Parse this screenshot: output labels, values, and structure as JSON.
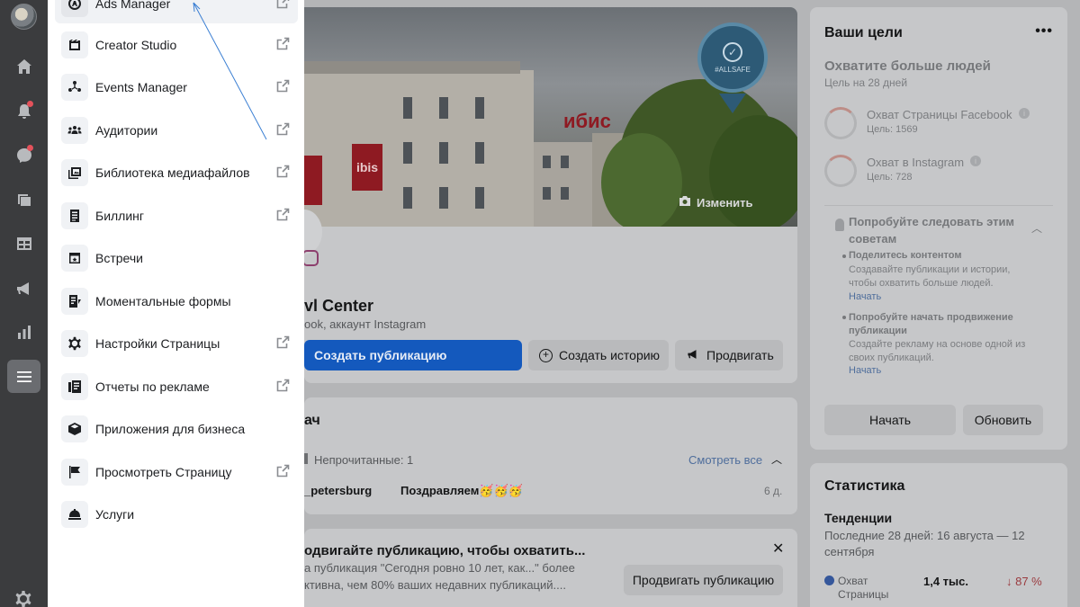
{
  "rail": {
    "items": [
      "home",
      "notifications",
      "messages",
      "pages",
      "grid",
      "ads",
      "insights",
      "menu",
      "settings"
    ]
  },
  "menu": {
    "items": [
      {
        "label": "Ads Manager",
        "icon": "ads-manager-icon",
        "external": true
      },
      {
        "label": "Creator Studio",
        "icon": "creator-studio-icon",
        "external": true
      },
      {
        "label": "Events Manager",
        "icon": "events-manager-icon",
        "external": true
      },
      {
        "label": "Аудитории",
        "icon": "audiences-icon",
        "external": true
      },
      {
        "label": "Библиотека медиафайлов",
        "icon": "media-library-icon",
        "external": true
      },
      {
        "label": "Биллинг",
        "icon": "billing-icon",
        "external": true
      },
      {
        "label": "Встречи",
        "icon": "appointments-icon",
        "external": false
      },
      {
        "label": "Моментальные формы",
        "icon": "instant-forms-icon",
        "external": false
      },
      {
        "label": "Настройки Страницы",
        "icon": "page-settings-icon",
        "external": true
      },
      {
        "label": "Отчеты по рекламе",
        "icon": "ad-reports-icon",
        "external": true
      },
      {
        "label": "Приложения для бизнеса",
        "icon": "business-apps-icon",
        "external": false
      },
      {
        "label": "Просмотреть Страницу",
        "icon": "view-page-icon",
        "external": true
      },
      {
        "label": "Услуги",
        "icon": "services-icon",
        "external": false
      }
    ]
  },
  "cover": {
    "change_label": "Изменить",
    "badge_text": "#ALLSAFE",
    "sign_text": "ibis",
    "building_text": "ибис"
  },
  "profile": {
    "name": "vl Center",
    "sub": "ook, аккаунт Instagram",
    "create_post": "Создать публикацию",
    "create_story": "Создать историю",
    "promote": "Продвигать"
  },
  "inbox": {
    "title": "ач",
    "unread": "Непрочитанные: 1",
    "see_all": "Смотреть все",
    "sender": "_petersburg",
    "message": "Поздравляем🥳🥳🥳",
    "age": "6 д."
  },
  "promo": {
    "title": "одвигайте публикацию, чтобы охватить...",
    "line1": "а публикация \"Сегодня ровно 10 лет, как...\" более",
    "line2": "ктивна, чем 80% ваших недавних публикаций....",
    "button": "Продвигать публикацию"
  },
  "goals": {
    "title": "Ваши цели",
    "more": "•••",
    "heading": "Охватите больше людей",
    "period": "Цель на 28 дней",
    "goal1_label": "Охват Страницы Facebook",
    "goal1_target": "Цель: 1569",
    "goal2_label": "Охват в Instagram",
    "goal2_target": "Цель: 728",
    "tips_title": "Попробуйте следовать этим советам",
    "tip1_title": "Поделитесь контентом",
    "tip1_body": "Создавайте публикации и истории, чтобы охватить больше людей.",
    "tip1_link": "Начать",
    "tip2_title": "Попробуйте начать продвижение публикации",
    "tip2_body": "Создайте рекламу на основе одной из своих публикаций.",
    "tip2_link": "Начать",
    "start": "Начать",
    "update": "Обновить"
  },
  "stats": {
    "title": "Статистика",
    "trends": "Тенденции",
    "range": "Последние 28 дней: 16 августа — 12 сентября",
    "metric_label": "Охват Страницы",
    "metric_value": "1,4 тыс.",
    "metric_change": "↓ 87 %"
  }
}
